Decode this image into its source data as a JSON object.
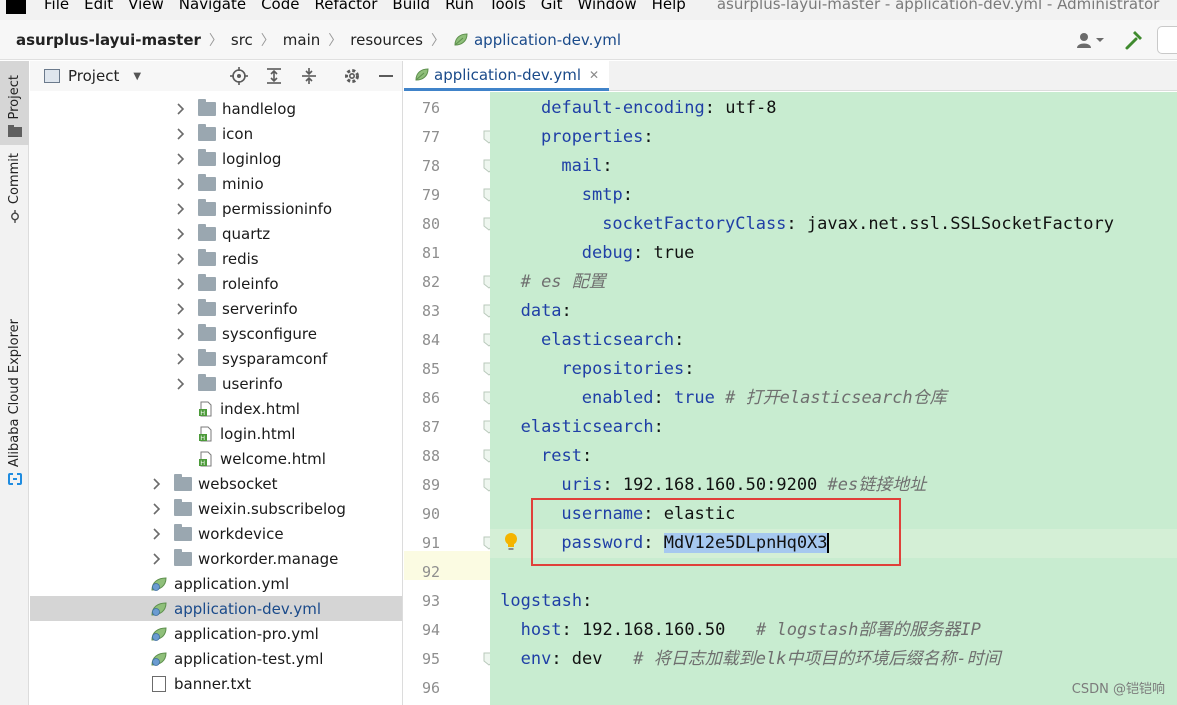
{
  "menu": {
    "items": [
      "File",
      "Edit",
      "View",
      "Navigate",
      "Code",
      "Refactor",
      "Build",
      "Run",
      "Tools",
      "Git",
      "Window",
      "Help"
    ],
    "window_title": "asurplus-layui-master - application-dev.yml - Administrator"
  },
  "breadcrumb": {
    "project": "asurplus-layui-master",
    "items": [
      "src",
      "main",
      "resources"
    ],
    "file": "application-dev.yml"
  },
  "tool_stripe": {
    "project": "Project",
    "commit": "Commit",
    "alibaba": "Alibaba Cloud Explorer"
  },
  "project_panel": {
    "title": "Project",
    "tree": [
      {
        "label": "handlelog",
        "type": "folder",
        "indent": 1,
        "expandable": true
      },
      {
        "label": "icon",
        "type": "folder",
        "indent": 1,
        "expandable": true
      },
      {
        "label": "loginlog",
        "type": "folder",
        "indent": 1,
        "expandable": true
      },
      {
        "label": "minio",
        "type": "folder",
        "indent": 1,
        "expandable": true
      },
      {
        "label": "permissioninfo",
        "type": "folder",
        "indent": 1,
        "expandable": true
      },
      {
        "label": "quartz",
        "type": "folder",
        "indent": 1,
        "expandable": true
      },
      {
        "label": "redis",
        "type": "folder",
        "indent": 1,
        "expandable": true
      },
      {
        "label": "roleinfo",
        "type": "folder",
        "indent": 1,
        "expandable": true
      },
      {
        "label": "serverinfo",
        "type": "folder",
        "indent": 1,
        "expandable": true
      },
      {
        "label": "sysconfigure",
        "type": "folder",
        "indent": 1,
        "expandable": true
      },
      {
        "label": "sysparamconf",
        "type": "folder",
        "indent": 1,
        "expandable": true
      },
      {
        "label": "userinfo",
        "type": "folder",
        "indent": 1,
        "expandable": true
      },
      {
        "label": "index.html",
        "type": "html",
        "indent": 1,
        "expandable": false
      },
      {
        "label": "login.html",
        "type": "html",
        "indent": 1,
        "expandable": false
      },
      {
        "label": "welcome.html",
        "type": "html",
        "indent": 1,
        "expandable": false
      },
      {
        "label": "websocket",
        "type": "folder",
        "indent": 0,
        "expandable": true
      },
      {
        "label": "weixin.subscribelog",
        "type": "folder",
        "indent": 0,
        "expandable": true
      },
      {
        "label": "workdevice",
        "type": "folder",
        "indent": 0,
        "expandable": true
      },
      {
        "label": "workorder.manage",
        "type": "folder",
        "indent": 0,
        "expandable": true
      },
      {
        "label": "application.yml",
        "type": "yml",
        "indent": -1,
        "expandable": false
      },
      {
        "label": "application-dev.yml",
        "type": "yml",
        "indent": -1,
        "expandable": false,
        "selected": true
      },
      {
        "label": "application-pro.yml",
        "type": "yml",
        "indent": -1,
        "expandable": false
      },
      {
        "label": "application-test.yml",
        "type": "yml",
        "indent": -1,
        "expandable": false
      },
      {
        "label": "banner.txt",
        "type": "txt",
        "indent": -1,
        "expandable": false
      }
    ]
  },
  "editor": {
    "tab_label": "application-dev.yml",
    "current_line": 91,
    "lines": [
      {
        "no": "76",
        "indent": "  ",
        "key": "default-encoding",
        "value": "utf-8",
        "comment": ""
      },
      {
        "no": "77",
        "indent": "  ",
        "key": "properties",
        "value": "",
        "comment": ""
      },
      {
        "no": "78",
        "indent": "    ",
        "key": "mail",
        "value": "",
        "comment": ""
      },
      {
        "no": "79",
        "indent": "      ",
        "key": "smtp",
        "value": "",
        "comment": ""
      },
      {
        "no": "80",
        "indent": "        ",
        "key": "socketFactoryClass",
        "value": "javax.net.ssl.SSLSocketFactory",
        "comment": ""
      },
      {
        "no": "81",
        "indent": "      ",
        "key": "debug",
        "value": "true",
        "comment": ""
      },
      {
        "no": "82",
        "indent": "",
        "key": "",
        "value": "",
        "comment": "# es 配置"
      },
      {
        "no": "83",
        "indent": "",
        "key": "data",
        "value": "",
        "comment": ""
      },
      {
        "no": "84",
        "indent": "  ",
        "key": "elasticsearch",
        "value": "",
        "comment": ""
      },
      {
        "no": "85",
        "indent": "    ",
        "key": "repositories",
        "value": "",
        "comment": ""
      },
      {
        "no": "86",
        "indent": "      ",
        "key": "enabled",
        "value": "true",
        "comment": "# 打开elasticsearch仓库",
        "value_kw": true
      },
      {
        "no": "87",
        "indent": "",
        "key": "elasticsearch",
        "value": "",
        "comment": ""
      },
      {
        "no": "88",
        "indent": "  ",
        "key": "rest",
        "value": "",
        "comment": ""
      },
      {
        "no": "89",
        "indent": "    ",
        "key": "uris",
        "value": "192.168.160.50:9200",
        "comment": "#es链接地址"
      },
      {
        "no": "90",
        "indent": "    ",
        "key": "username",
        "value": "elastic",
        "comment": ""
      },
      {
        "no": "91",
        "indent": "    ",
        "key": "password",
        "value": "MdV12e5DLpnHq0X3",
        "comment": "",
        "selected": true
      },
      {
        "no": "92",
        "indent": "",
        "key": "",
        "value": "",
        "comment": ""
      },
      {
        "no": "93",
        "indent": "",
        "key": "logstash",
        "value": "",
        "comment": "",
        "root": true
      },
      {
        "no": "94",
        "indent": "",
        "key": "host",
        "value": "192.168.160.50",
        "comment": "# logstash部署的服务器IP",
        "gap": "  "
      },
      {
        "no": "95",
        "indent": "",
        "key": "env",
        "value": "dev",
        "comment": "# 将日志加载到elk中项目的环境后缀名称-时间",
        "gap": "  "
      },
      {
        "no": "96",
        "indent": "",
        "key": "",
        "value": "",
        "comment": ""
      }
    ]
  },
  "watermark": "CSDN @铠铠响",
  "colors": {
    "code_bg": "#c8ecd0",
    "key": "#1f3fa6",
    "comment": "#6f6f6f",
    "highlight_box": "#e0403a",
    "tab_underline": "#4083c9"
  }
}
